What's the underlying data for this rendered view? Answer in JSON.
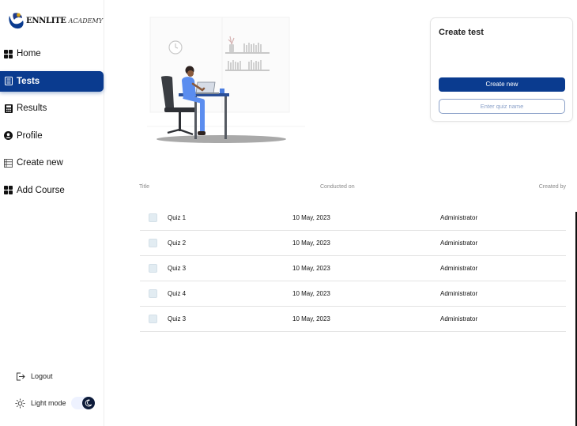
{
  "brand": {
    "name": "ENNLITE",
    "subtitle": "ACADEMY"
  },
  "sidebar": {
    "items": [
      {
        "label": "Home",
        "icon": "grid-icon",
        "active": false
      },
      {
        "label": "Tests",
        "icon": "document-icon",
        "active": true
      },
      {
        "label": "Results",
        "icon": "calculator-icon",
        "active": false
      },
      {
        "label": "Profile",
        "icon": "user-circle-icon",
        "active": false
      },
      {
        "label": "Create new",
        "icon": "list-icon",
        "active": false
      },
      {
        "label": "Add Course",
        "icon": "grid-icon",
        "active": false
      }
    ],
    "logout_label": "Logout",
    "light_mode_label": "Light mode"
  },
  "create_test": {
    "title": "Create test",
    "button_label": "Create new",
    "input_placeholder": "Enter quiz name",
    "input_value": ""
  },
  "table": {
    "headers": {
      "title": "Title",
      "conducted": "Conducted on",
      "created_by": "Created by"
    },
    "rows": [
      {
        "title": "Quiz 1",
        "date": "10 May, 2023",
        "created_by": "Administrator"
      },
      {
        "title": "Quiz 2",
        "date": "10 May, 2023",
        "created_by": "Administrator"
      },
      {
        "title": "Quiz 3",
        "date": "10 May, 2023",
        "created_by": "Administrator"
      },
      {
        "title": "Quiz 4",
        "date": "10 May, 2023",
        "created_by": "Administrator"
      },
      {
        "title": "Quiz 3",
        "date": "10 May, 2023",
        "created_by": "Administrator"
      }
    ]
  },
  "colors": {
    "primary": "#0a3b8f",
    "accent_blue": "#5b8def",
    "toggle_dark": "#0d1b3a"
  }
}
